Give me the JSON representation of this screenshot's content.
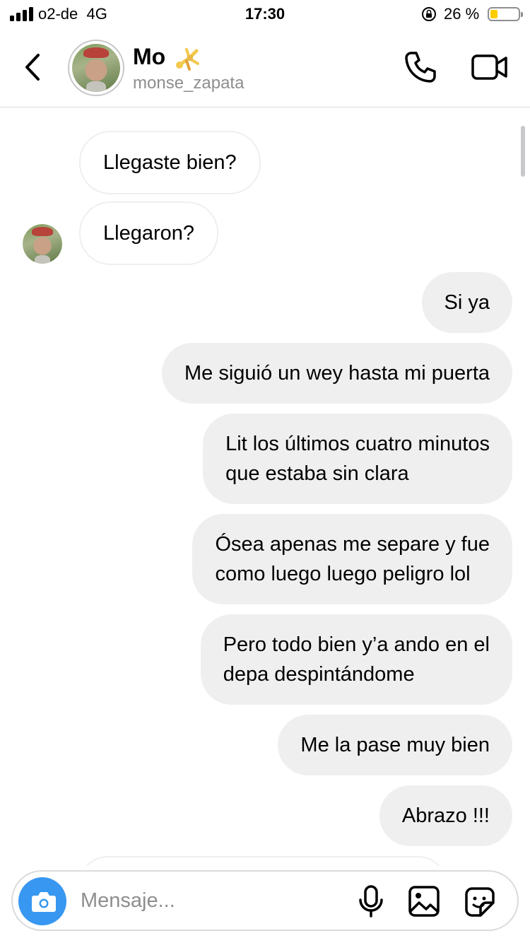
{
  "status_bar": {
    "carrier": "o2-de",
    "network": "4G",
    "time": "17:30",
    "battery_percent": "26 %",
    "battery_level": 0.26,
    "icons": [
      "signal-icon",
      "orientation-lock-icon",
      "battery-icon"
    ]
  },
  "header": {
    "name": "Mo",
    "name_emoji": "person-cartwheeling",
    "handle": "monse_zapata",
    "icons": [
      "chevron-left-icon",
      "phone-icon",
      "video-camera-icon"
    ]
  },
  "messages": [
    {
      "direction": "in",
      "text": "Llegaste bien?"
    },
    {
      "direction": "in",
      "text": "Llegaron?",
      "show_avatar": true
    },
    {
      "direction": "out",
      "text": "Si ya"
    },
    {
      "direction": "out",
      "text": "Me siguió un wey hasta mi puerta"
    },
    {
      "direction": "out",
      "lines": [
        "Lit los últimos cuatro minutos",
        "que estaba sin clara"
      ]
    },
    {
      "direction": "out",
      "lines": [
        "Ósea apenas me separe y fue",
        "como luego luego peligro lol"
      ]
    },
    {
      "direction": "out",
      "lines": [
        "Pero todo bien y’a ando en el",
        "depa despintándome"
      ]
    },
    {
      "direction": "out",
      "text": "Me la pase muy bien"
    },
    {
      "direction": "out",
      "text": "Abrazo !!!"
    }
  ],
  "composer": {
    "placeholder": "Mensaje...",
    "value": "",
    "accent_color": "#3897f0",
    "icons": [
      "camera-icon",
      "microphone-icon",
      "gallery-icon",
      "sticker-icon"
    ]
  },
  "colors": {
    "outgoing_bubble": "#efefef",
    "incoming_bubble_border": "#efefef",
    "secondary_text": "#8e8e8e"
  }
}
